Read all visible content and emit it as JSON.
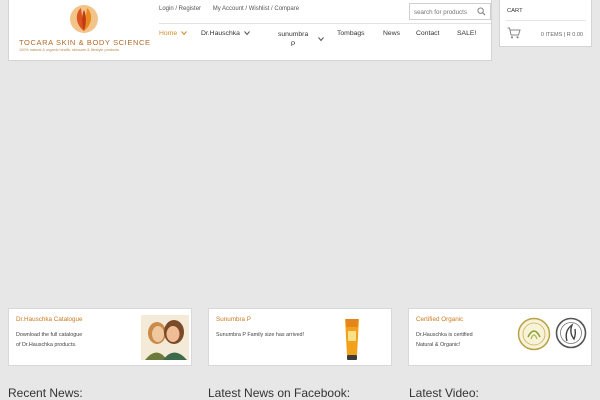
{
  "header": {
    "logo": {
      "title": "TOCARA SKIN & BODY SCIENCE",
      "tagline": "100% natural & organic health, skincare & lifestyle products"
    },
    "top_links": {
      "login": "Login / Register",
      "account": "My Account / Wishlist / Compare"
    },
    "search": {
      "placeholder": "search for products"
    },
    "nav": [
      {
        "label": "Home",
        "active": true
      },
      {
        "label": "Dr.Hauschka"
      },
      {
        "label": "sunumbra",
        "label2": "P"
      },
      {
        "label": "Tombags"
      },
      {
        "label": "News"
      },
      {
        "label": "Contact"
      },
      {
        "label": "SALE!"
      }
    ]
  },
  "cart": {
    "label": "CART",
    "summary": "0 ITEMS | R 0.00"
  },
  "features": [
    {
      "title": "Dr.Hauschka Catalogue",
      "line1": "Download the full catalogue",
      "line2": "of Dr.Hauschka products."
    },
    {
      "title": "Sunumbra P",
      "line1": "Sunumbra P Family size has arrived!"
    },
    {
      "title": "Certified Organic",
      "line1": "Dr.Hauschka is certified",
      "line2": "Natural & Organic!"
    }
  ],
  "bottom_headings": {
    "news": "Recent News:",
    "facebook": "Latest News on Facebook:",
    "video": "Latest Video:"
  },
  "colors": {
    "accent": "#d98a2b",
    "background": "#e7e7e7"
  }
}
